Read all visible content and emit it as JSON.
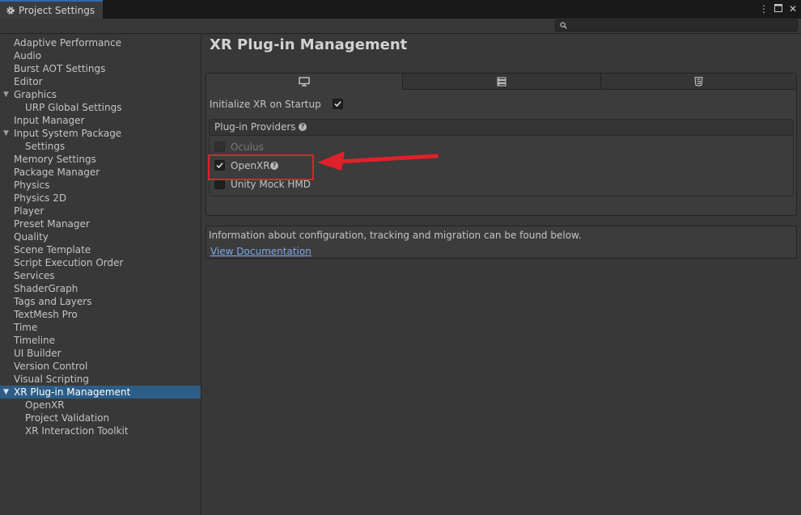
{
  "window": {
    "tab_title": "Project Settings",
    "tab_icon": "gear-icon",
    "controls": [
      "kebab-menu-icon",
      "maximize-icon",
      "close-icon"
    ]
  },
  "search": {
    "placeholder": "",
    "value": ""
  },
  "sidebar": {
    "items": [
      {
        "label": "Adaptive Performance"
      },
      {
        "label": "Audio"
      },
      {
        "label": "Burst AOT Settings"
      },
      {
        "label": "Editor"
      },
      {
        "label": "Graphics",
        "expanded": true
      },
      {
        "label": "URP Global Settings"
      },
      {
        "label": "Input Manager"
      },
      {
        "label": "Input System Package",
        "expanded": true
      },
      {
        "label": "Settings"
      },
      {
        "label": "Memory Settings"
      },
      {
        "label": "Package Manager"
      },
      {
        "label": "Physics"
      },
      {
        "label": "Physics 2D"
      },
      {
        "label": "Player"
      },
      {
        "label": "Preset Manager"
      },
      {
        "label": "Quality"
      },
      {
        "label": "Scene Template"
      },
      {
        "label": "Script Execution Order"
      },
      {
        "label": "Services"
      },
      {
        "label": "ShaderGraph"
      },
      {
        "label": "Tags and Layers"
      },
      {
        "label": "TextMesh Pro"
      },
      {
        "label": "Time"
      },
      {
        "label": "Timeline"
      },
      {
        "label": "UI Builder"
      },
      {
        "label": "Version Control"
      },
      {
        "label": "Visual Scripting"
      },
      {
        "label": "XR Plug-in Management",
        "expanded": true,
        "selected": true
      },
      {
        "label": "OpenXR"
      },
      {
        "label": "Project Validation"
      },
      {
        "label": "XR Interaction Toolkit"
      }
    ]
  },
  "main": {
    "title": "XR Plug-in Management",
    "platform_tabs": [
      {
        "icon": "desktop-icon",
        "active": true
      },
      {
        "icon": "server-icon",
        "active": false
      },
      {
        "icon": "html5-icon",
        "active": false
      }
    ],
    "init_xr_label": "Initialize XR on Startup",
    "init_xr_checked": true,
    "providers_header": "Plug-in Providers",
    "providers": [
      {
        "label": "Oculus",
        "checked": false,
        "enabled": false
      },
      {
        "label": "OpenXR",
        "checked": true,
        "enabled": true,
        "help": true
      },
      {
        "label": "Unity Mock HMD",
        "checked": false,
        "enabled": true
      }
    ],
    "info_text": "Information about configuration, tracking and migration can be found below.",
    "doc_link": "View Documentation"
  },
  "annotation": {
    "color": "#e0212a"
  },
  "colors": {
    "selection": "#2c5d87",
    "link": "#7ea7ea",
    "tab_accent": "#2d6ab4"
  }
}
